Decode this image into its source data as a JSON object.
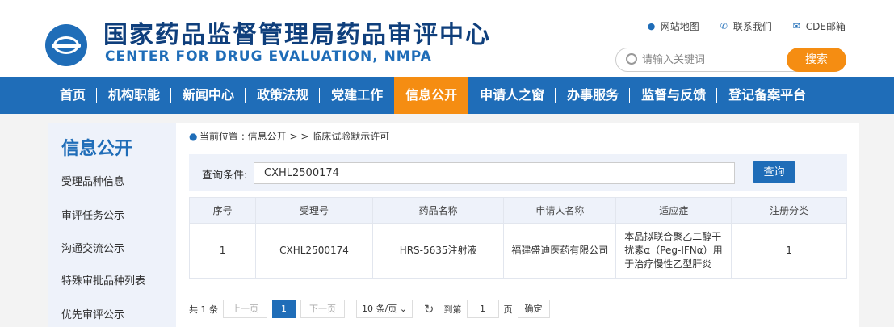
{
  "header": {
    "title_cn": "国家药品监督管理局药品审评中心",
    "title_en": "CENTER FOR DRUG EVALUATION, NMPA",
    "links": [
      "网站地图",
      "联系我们",
      "CDE邮箱"
    ],
    "search_placeholder": "请输入关键词",
    "search_button": "搜索"
  },
  "nav": {
    "items": [
      "首页",
      "机构职能",
      "新闻中心",
      "政策法规",
      "党建工作",
      "信息公开",
      "申请人之窗",
      "办事服务",
      "监督与反馈",
      "登记备案平台"
    ],
    "active": "信息公开"
  },
  "sidebar": {
    "title": "信息公开",
    "items": [
      "受理品种信息",
      "审评任务公示",
      "沟通交流公示",
      "特殊审批品种列表",
      "优先审评公示"
    ]
  },
  "breadcrumb": {
    "prefix": "当前位置 : 信息公开 > > 临床试验默示许可"
  },
  "query": {
    "label": "查询条件:",
    "value": "CXHL2500174",
    "button": "查询"
  },
  "table": {
    "headers": [
      "序号",
      "受理号",
      "药品名称",
      "申请人名称",
      "适应症",
      "注册分类"
    ],
    "rows": [
      [
        "1",
        "CXHL2500174",
        "HRS-5635注射液",
        "福建盛迪医药有限公司",
        "本品拟联合聚乙二醇干扰素α（Peg-IFNα）用于治疗慢性乙型肝炎",
        "1"
      ]
    ]
  },
  "pager": {
    "total": "共 1 条",
    "prev": "上一页",
    "current": "1",
    "next": "下一页",
    "size": "10 条/页",
    "goto_label": "到第",
    "goto_value": "1",
    "page_unit": "页",
    "confirm": "确定"
  },
  "colors": {
    "brand_blue": "#1f6db8",
    "accent_orange": "#f58d12"
  }
}
